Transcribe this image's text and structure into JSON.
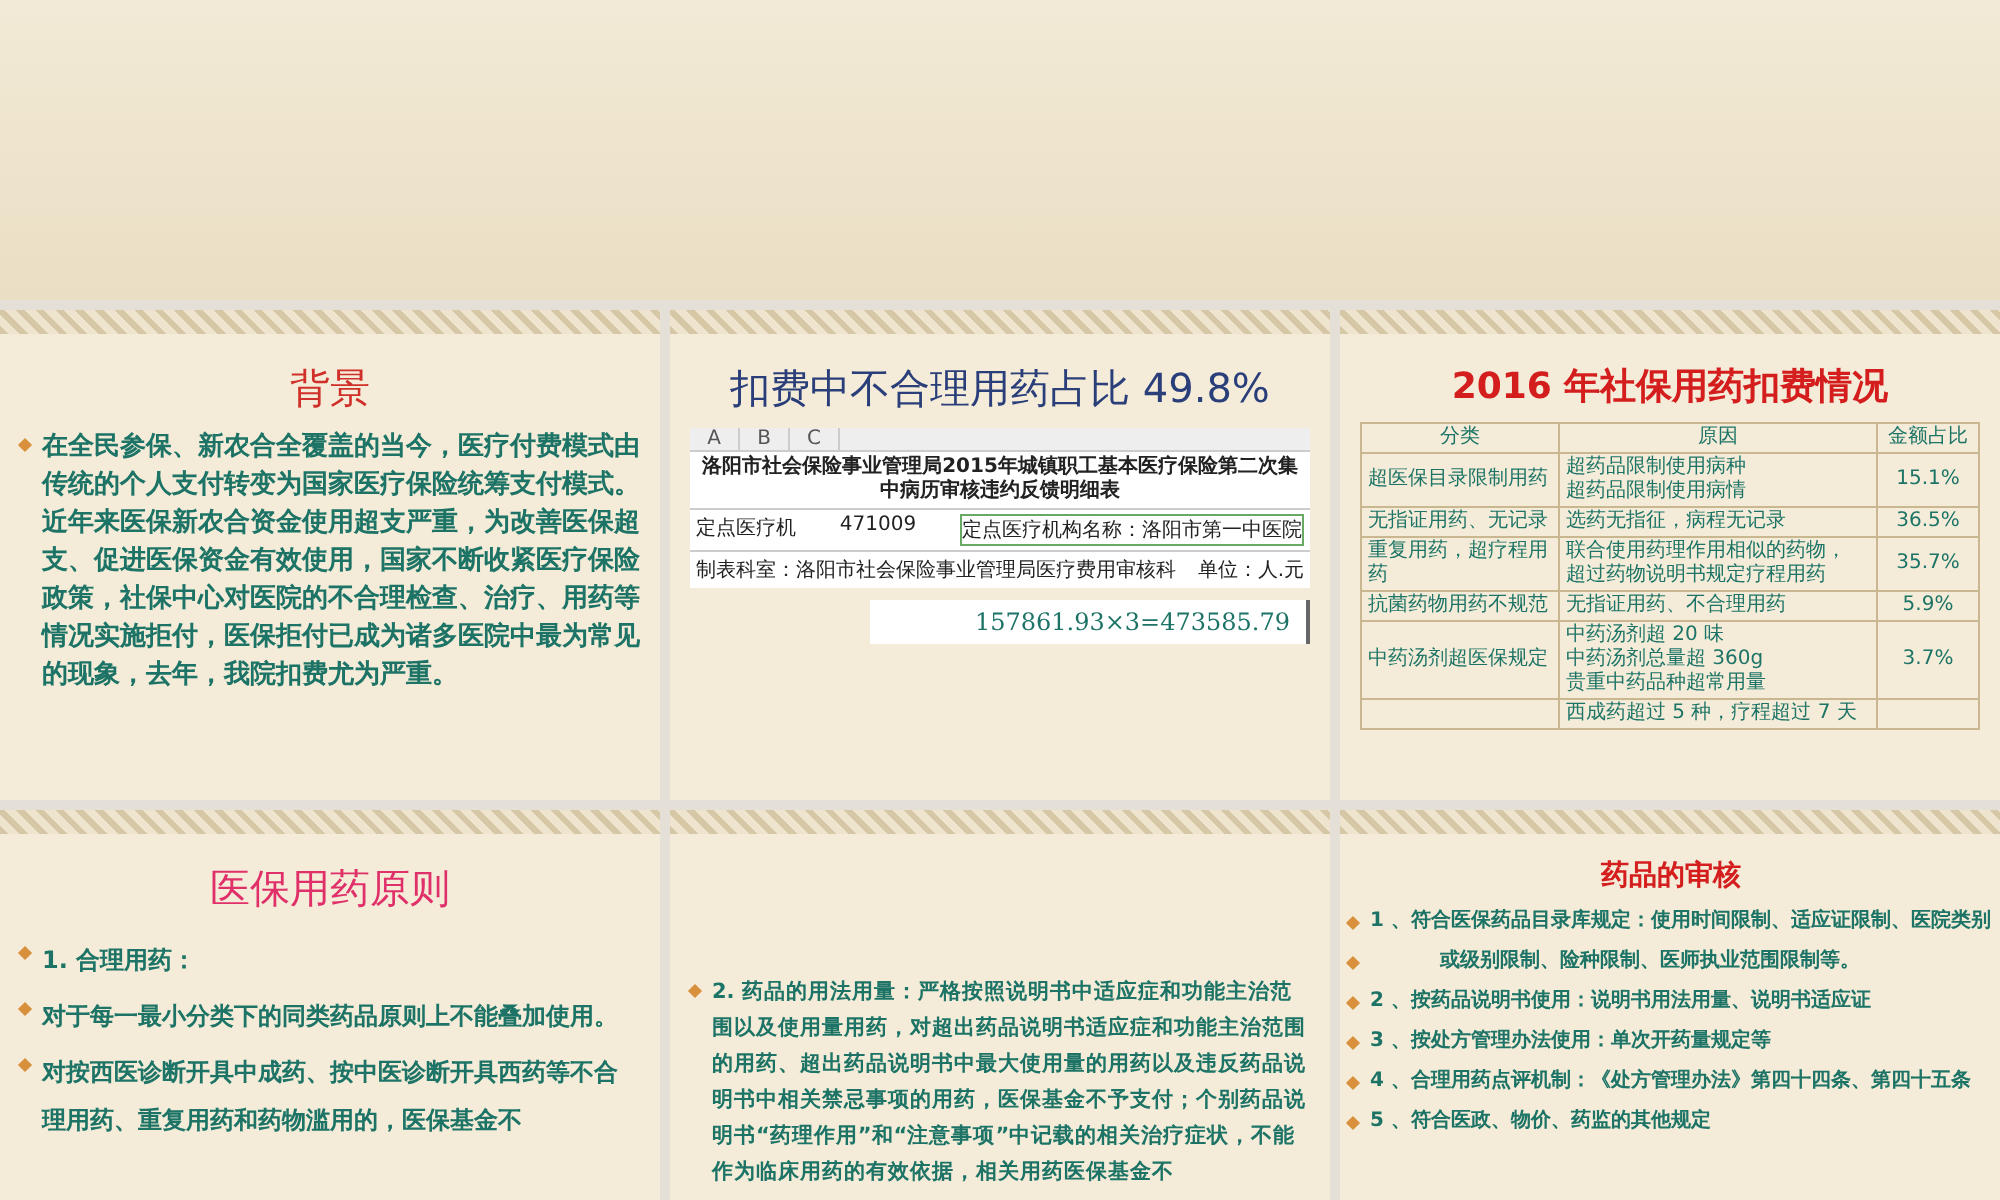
{
  "slides": [
    {
      "kind": "text",
      "title": "背景",
      "bullets": [
        "在全民参保、新农合全覆盖的当今，医疗付费模式由传统的个人支付转变为国家医疗保险统筹支付模式。近年来医保新农合资金使用超支严重，为改善医保超支、促进医保资金有效使用，国家不断收紧医疗保险政策，社保中心对医院的不合理检查、治疗、用药等情况实施拒付，医保拒付已成为诸多医院中最为常见的现象，去年，我院扣费尤为严重。"
      ]
    },
    {
      "kind": "spreadsheet",
      "title": "扣费中不合理用药占比 49.8%",
      "sheet": {
        "columns": [
          "A",
          "B",
          "C"
        ],
        "heading": "洛阳市社会保险事业管理局2015年城镇职工基本医疗保险第二次集中病历审核违约反馈明细表",
        "institution_label": "定点医疗机",
        "institution_code": "471009",
        "institution_name": "定点医疗机构名称：洛阳市第一中医院",
        "department": "制表科室：洛阳市社会保险事业管理局医疗费用审核科",
        "unit": "单位：人.元",
        "formula": "157861.93×3=473585.79"
      }
    },
    {
      "kind": "table",
      "title": "2016 年社保用药扣费情况",
      "columns": [
        "分类",
        "原因",
        "金额占比"
      ],
      "rows": [
        {
          "category": "超医保目录限制用药",
          "reasons": [
            "超药品限制使用病种",
            "超药品限制使用病情"
          ],
          "share": "15.1%"
        },
        {
          "category": "无指证用药、无记录",
          "reasons": [
            "选药无指征，病程无记录"
          ],
          "share": "36.5%"
        },
        {
          "category": "重复用药，超疗程用药",
          "reasons": [
            "联合使用药理作用相似的药物，",
            "超过药物说明书规定疗程用药"
          ],
          "share": "35.7%"
        },
        {
          "category": "抗菌药物用药不规范",
          "reasons": [
            "无指证用药、不合理用药"
          ],
          "share": "5.9%"
        },
        {
          "category": "中药汤剂超医保规定",
          "reasons": [
            "中药汤剂超 20 味",
            "中药汤剂总量超 360g",
            "贵重中药品种超常用量"
          ],
          "share": "3.7%"
        },
        {
          "reasons": [
            "西成药超过 5 种，疗程超过 7 天"
          ]
        }
      ]
    },
    {
      "kind": "text",
      "title": "医保用药原则",
      "bullets": [
        "1. 合理用药：",
        "对于每一最小分类下的同类药品原则上不能叠加使用。",
        "对按西医诊断开具中成药、按中医诊断开具西药等不合理用药、重复用药和药物滥用的，医保基金不"
      ]
    },
    {
      "kind": "text",
      "bullets": [
        "2. 药品的用法用量：严格按照说明书中适应症和功能主治范围以及使用量用药，对超出药品说明书适应症和功能主治范围的用药、超出药品说明书中最大使用量的用药以及违反药品说明书中相关禁忌事项的用药，医保基金不予支付；个别药品说明书“药理作用”和“注意事项”中记载的相关治疗症状，不能作为临床用药的有效依据，相关用药医保基金不"
      ]
    },
    {
      "kind": "text",
      "title": "药品的审核",
      "bullets": [
        "1 、符合医保药品目录库规定：使用时间限制、适应证限制、医院类别",
        "          或级别限制、险种限制、医师执业范围限制等。",
        "2 、按药品说明书使用：说明书用法用量、说明书适应证",
        "3 、按处方管理办法使用：单次开药量规定等",
        "4 、合理用药点评机制：《处方管理办法》第四十四条、第四十五条",
        "5 、符合医政、物价、药监的其他规定"
      ]
    }
  ]
}
